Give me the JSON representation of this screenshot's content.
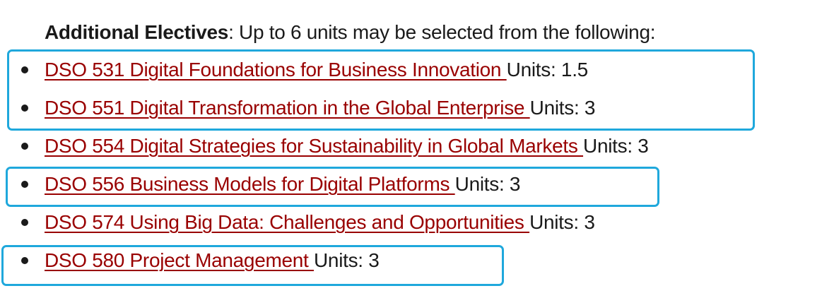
{
  "intro": {
    "heading": "Additional Electives",
    "text": ": Up to 6 units may be selected from the following:"
  },
  "courses": [
    {
      "link": "DSO 531 Digital Foundations for Business Innovation ",
      "units": "Units: 1.5",
      "highlighted": true
    },
    {
      "link": "DSO 551 Digital Transformation in the Global Enterprise ",
      "units": "Units: 3",
      "highlighted": true
    },
    {
      "link": "DSO 554 Digital Strategies for Sustainability in Global Markets ",
      "units": "Units: 3",
      "highlighted": false
    },
    {
      "link": "DSO 556 Business Models for Digital Platforms ",
      "units": "Units: 3",
      "highlighted": true
    },
    {
      "link": "DSO 574 Using Big Data: Challenges and Opportunities ",
      "units": "Units: 3",
      "highlighted": false
    },
    {
      "link": "DSO 580 Project Management ",
      "units": "Units: 3",
      "highlighted": true
    }
  ],
  "colors": {
    "link": "#990000",
    "text": "#1a1a1a",
    "highlight_border": "#1fa8dc",
    "background": "#ffffff"
  }
}
